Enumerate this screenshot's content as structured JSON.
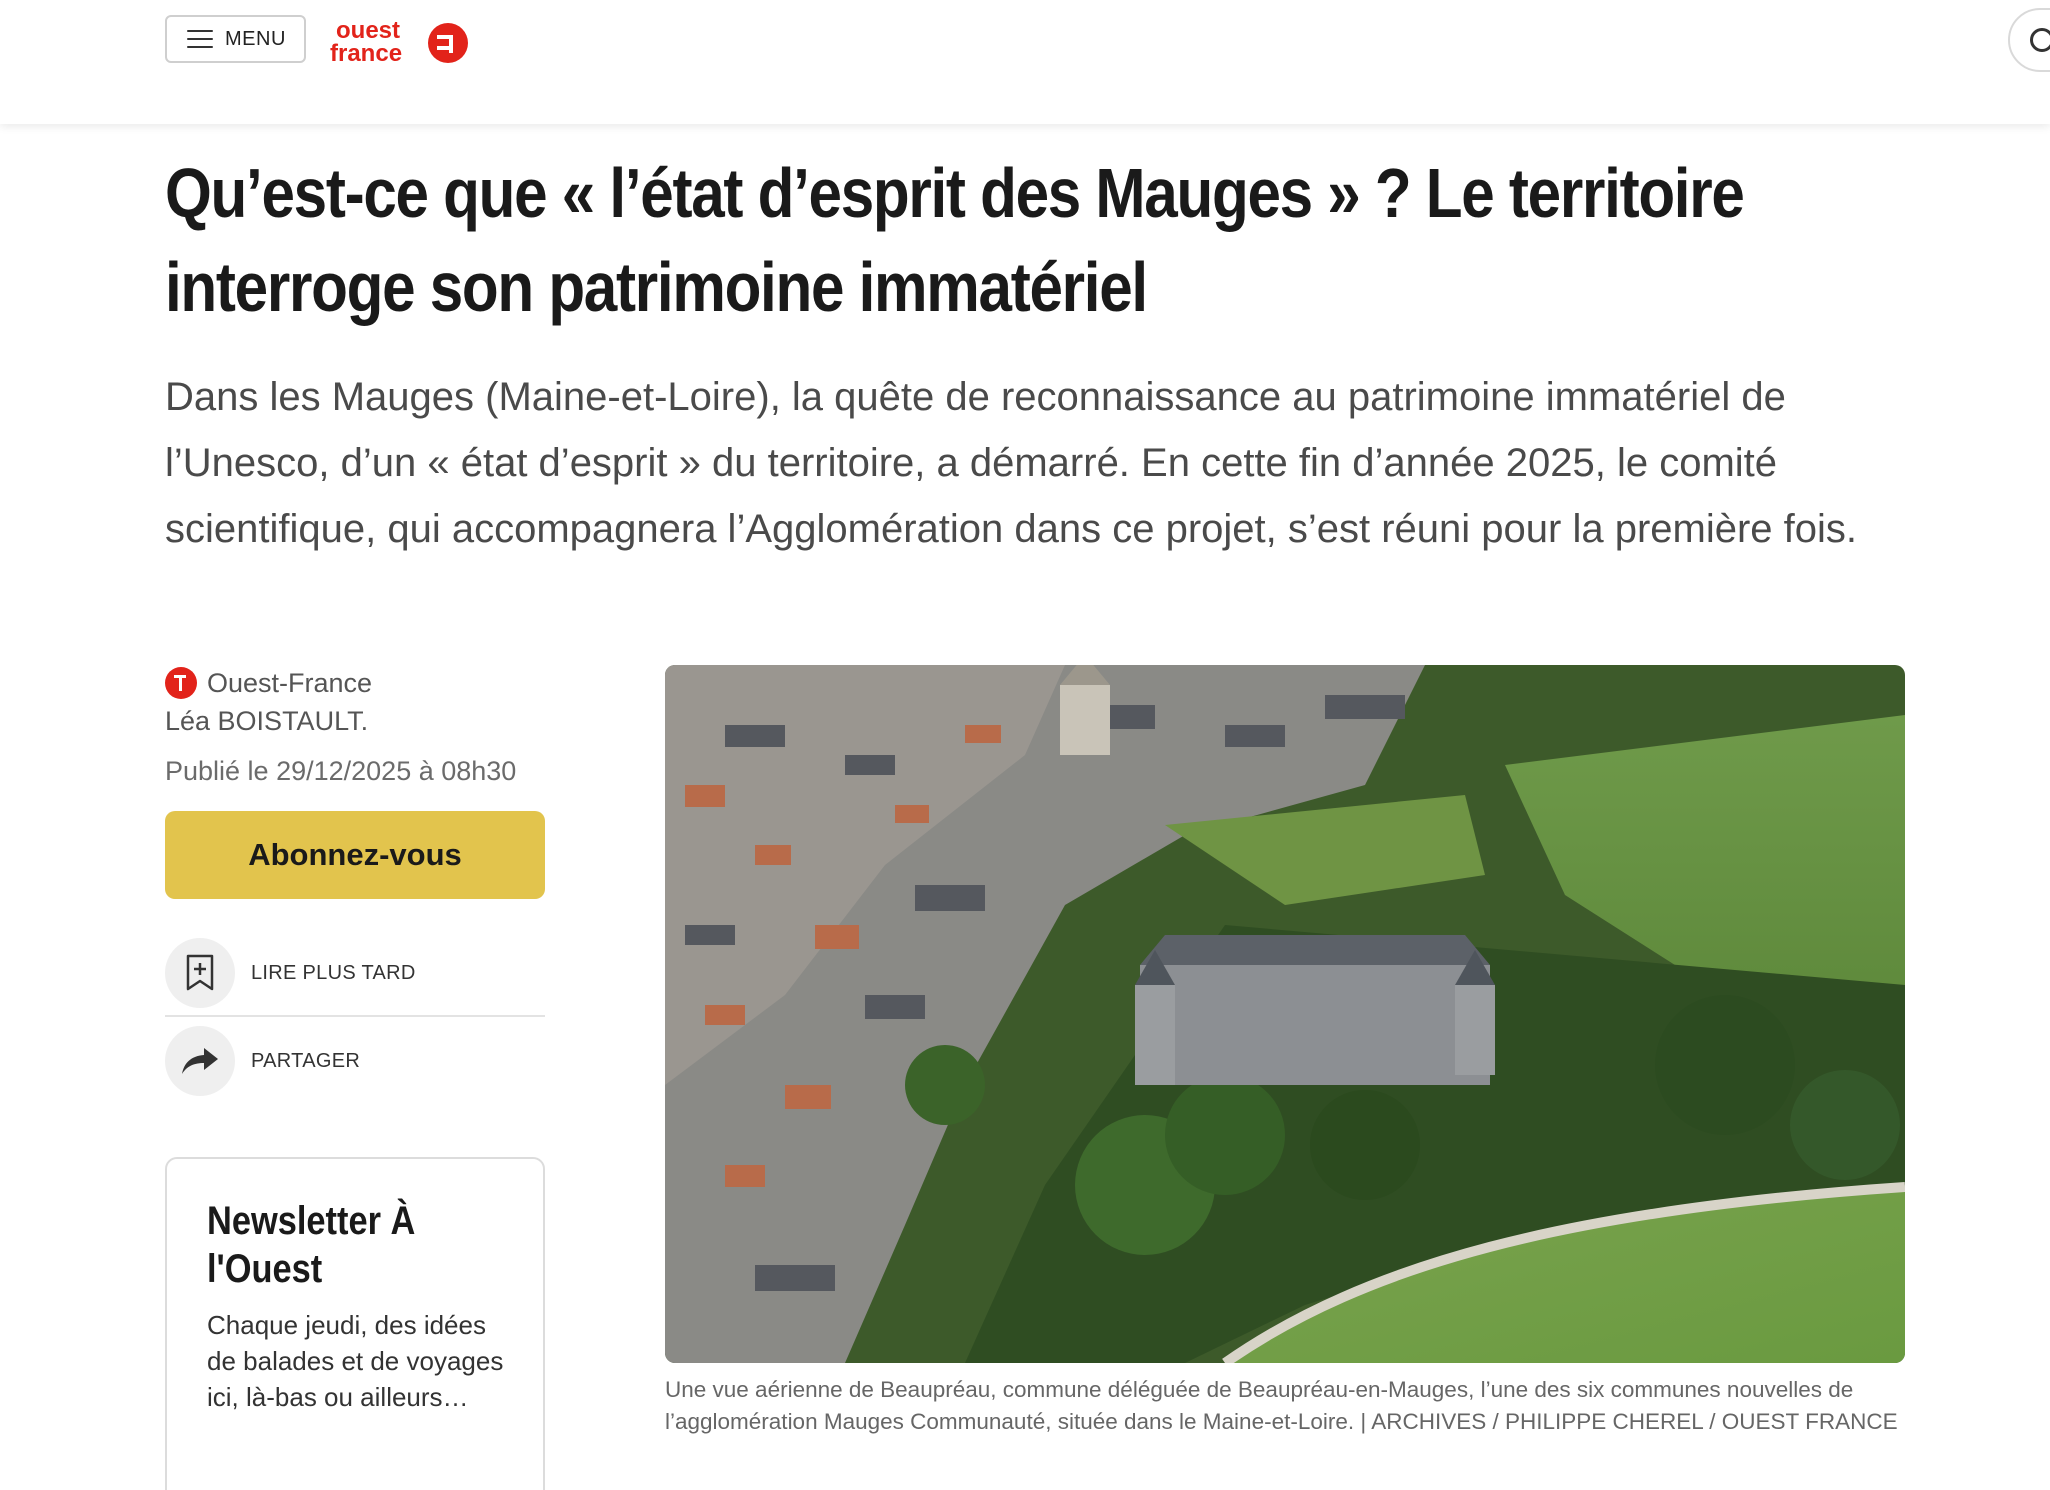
{
  "header": {
    "menu_label": "MENU",
    "logo_top": "ouest",
    "logo_bottom": "france",
    "brand_color": "#e2231a"
  },
  "article": {
    "title": "Qu’est-ce que « l’état d’esprit des Mauges » ? Le territoire interroge son patrimoine immatériel",
    "lede": "Dans les Mauges (Maine-et-Loire), la quête de reconnaissance au patrimoine immatériel de l’Unesco, d’un « état d’esprit » du territoire, a démarré. En cette fin d’année 2025, le comité scientifique, qui accompagnera l’Agglomération dans ce projet, s’est réuni pour la première fois.",
    "source": "Ouest-France",
    "author": "Léa BOISTAULT.",
    "published": "Publié le 29/12/2025 à 08h30",
    "subscribe_label": "Abonnez-vous",
    "read_later_label": "LIRE PLUS TARD",
    "share_label": "PARTAGER",
    "caption": "Une vue aérienne de Beaupréau, commune déléguée de Beaupréau-en-Mauges, l’une des six communes nouvelles de l’agglomération Mauges Communauté, située dans le Maine-et-Loire. | ARCHIVES / PHILIPPE CHEREL / OUEST FRANCE"
  },
  "newsletter": {
    "title": "Newsletter À l'Ouest",
    "description": "Chaque jeudi, des idées de balades et de voyages ici, là-bas ou ailleurs…"
  },
  "colors": {
    "subscribe_bg": "#e2c44d",
    "lede_text": "#4a4a4a"
  }
}
